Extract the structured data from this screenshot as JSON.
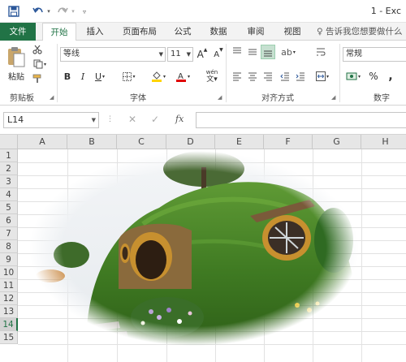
{
  "window": {
    "title_partial": "1 - Exc"
  },
  "quick_access": {
    "save": "save-icon",
    "undo": "undo-icon",
    "redo": "redo-icon",
    "customize": "customize-icon"
  },
  "tabs": [
    "文件",
    "开始",
    "插入",
    "页面布局",
    "公式",
    "数据",
    "审阅",
    "视图"
  ],
  "tell_me": "告诉我您想要做什么",
  "ribbon": {
    "clipboard": {
      "paste": "粘贴",
      "label": "剪贴板"
    },
    "font": {
      "name": "等线",
      "size": "11",
      "grow": "A",
      "shrink": "A",
      "bold": "B",
      "italic": "I",
      "underline": "U",
      "phonetic": "wén",
      "label": "字体"
    },
    "alignment": {
      "label": "对齐方式"
    },
    "number": {
      "format": "常规",
      "percent": "%",
      "comma": ",",
      "label": "数字"
    }
  },
  "formula_bar": {
    "name_box": "L14",
    "fx": "fx",
    "value": ""
  },
  "grid": {
    "columns": [
      "A",
      "B",
      "C",
      "D",
      "E",
      "F",
      "G",
      "H"
    ],
    "rows": [
      "1",
      "2",
      "3",
      "4",
      "5",
      "6",
      "7",
      "8",
      "9",
      "10",
      "11",
      "12",
      "13",
      "14",
      "15"
    ],
    "selected_row": "14"
  },
  "colors": {
    "accent": "#217346",
    "fill": "#ffd400",
    "font_color": "#e00000"
  }
}
